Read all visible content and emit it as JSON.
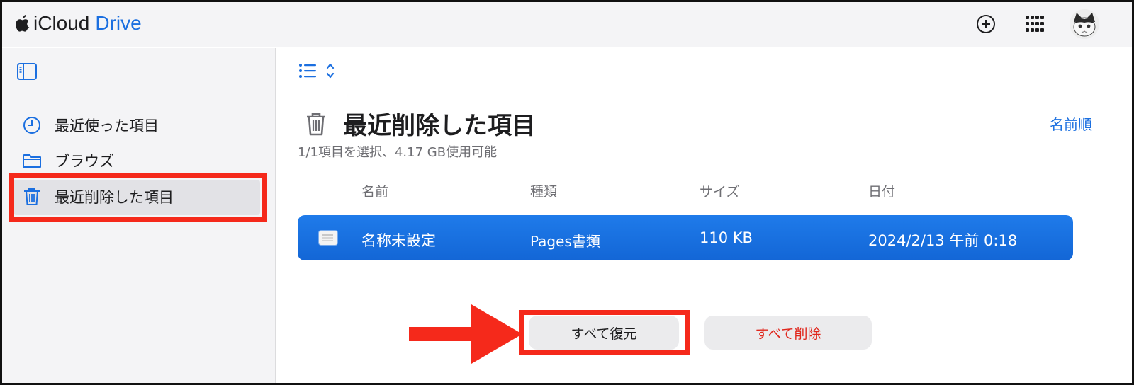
{
  "topbar": {
    "brand_prefix": "iCloud",
    "brand_suffix": "Drive",
    "icons": [
      "apple-logo-icon",
      "add-circle-icon",
      "app-grid-icon",
      "avatar"
    ]
  },
  "sidebar": {
    "items": [
      {
        "label": "最近使った項目",
        "icon": "clock-icon"
      },
      {
        "label": "ブラウズ",
        "icon": "folder-icon"
      },
      {
        "label": "最近削除した項目",
        "icon": "trash-icon",
        "selected": true
      }
    ]
  },
  "main": {
    "title": "最近削除した項目",
    "sort_label": "名前順",
    "subinfo": "1/1項目を選択、4.17 GB使用可能",
    "columns": [
      "名前",
      "種類",
      "サイズ",
      "日付"
    ],
    "rows": [
      {
        "name": "名称未設定",
        "kind": "Pages書類",
        "size": "110 KB",
        "date": "2024/2/13 午前 0:18",
        "selected": true
      }
    ],
    "buttons": {
      "restore_all": "すべて復元",
      "delete_all": "すべて削除"
    }
  },
  "colors": {
    "accent": "#1b6fe0",
    "selection": "#1a72e4",
    "danger_text": "#e0261c",
    "annotation_red": "#f5291b"
  }
}
